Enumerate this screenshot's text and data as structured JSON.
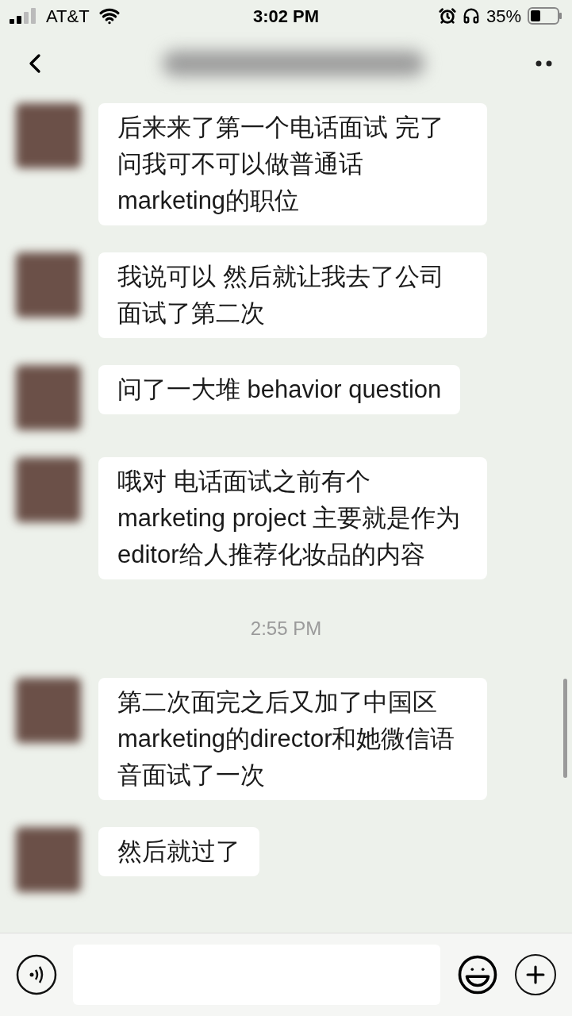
{
  "status_bar": {
    "carrier": "AT&T",
    "time": "3:02 PM",
    "battery": "35%"
  },
  "messages": [
    {
      "kind": "message",
      "text": "后来来了第一个电话面试 完了问我可不可以做普通话marketing的职位"
    },
    {
      "kind": "message",
      "text": "我说可以 然后就让我去了公司面试了第二次"
    },
    {
      "kind": "message",
      "text": "问了一大堆 behavior question"
    },
    {
      "kind": "message",
      "text": "哦对 电话面试之前有个marketing project 主要就是作为editor给人推荐化妆品的内容"
    },
    {
      "kind": "timestamp",
      "text": "2:55 PM"
    },
    {
      "kind": "message",
      "text": "第二次面完之后又加了中国区marketing的director和她微信语音面试了一次"
    },
    {
      "kind": "message",
      "text": "然后就过了"
    }
  ]
}
